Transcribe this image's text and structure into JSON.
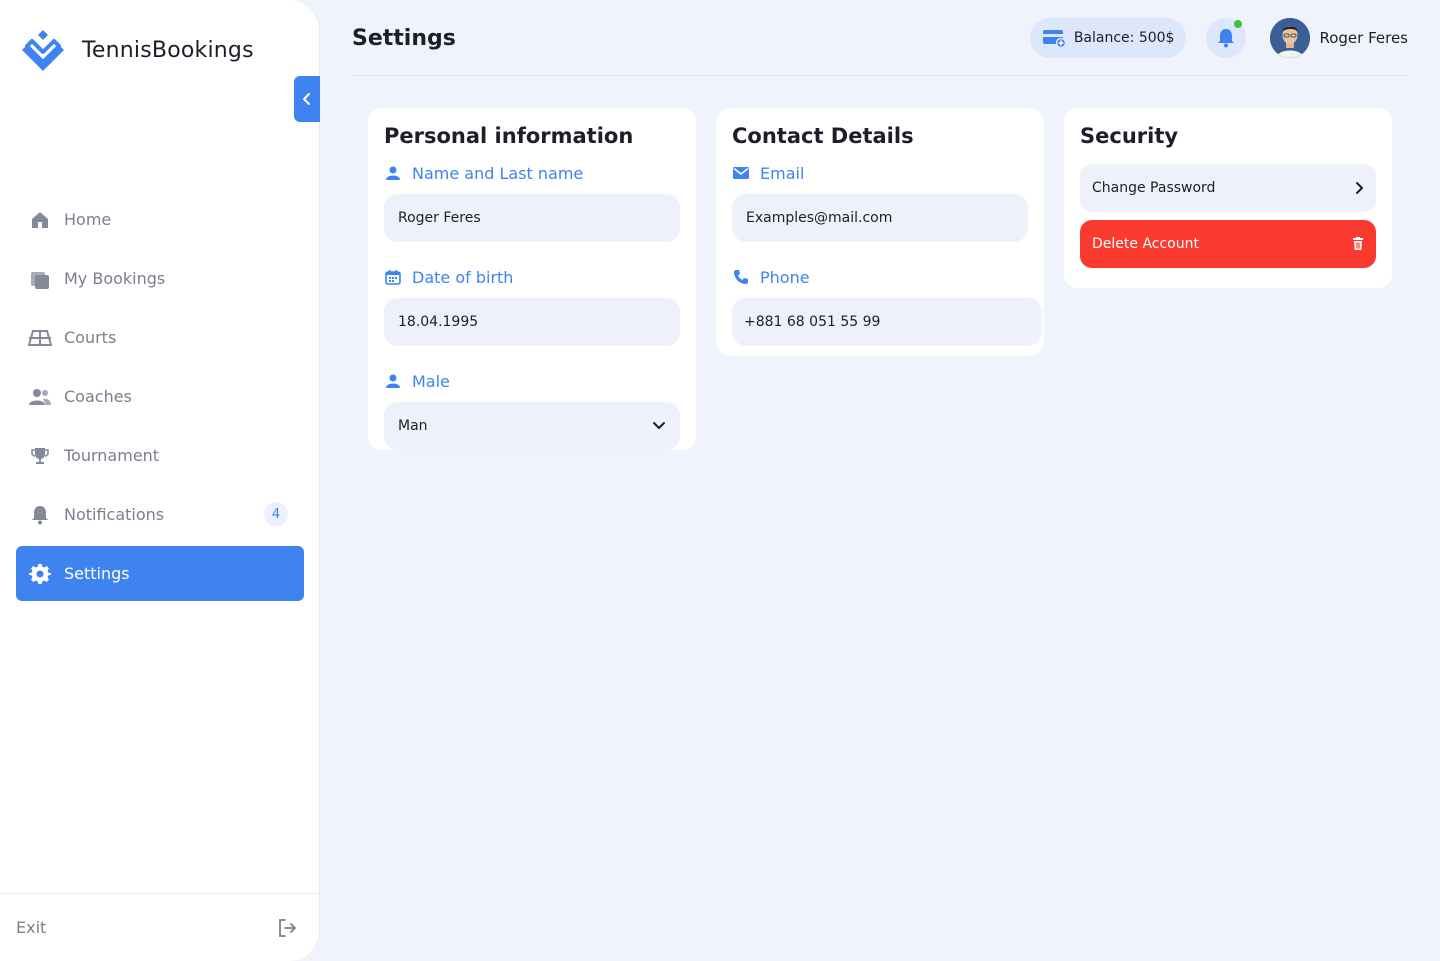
{
  "app": {
    "name": "TennisBookings"
  },
  "sidebar": {
    "items": [
      {
        "label": "Home",
        "icon": "home-icon"
      },
      {
        "label": "My Bookings",
        "icon": "bookings-icon"
      },
      {
        "label": "Courts",
        "icon": "court-icon"
      },
      {
        "label": "Coaches",
        "icon": "users-icon"
      },
      {
        "label": "Tournament",
        "icon": "trophy-icon"
      },
      {
        "label": "Notifications",
        "icon": "bell-icon",
        "badge": "4"
      },
      {
        "label": "Settings",
        "icon": "gear-icon",
        "active": true
      }
    ],
    "footer": {
      "exit_label": "Exit"
    }
  },
  "header": {
    "title": "Settings",
    "balance": "Balance: 500$",
    "user_name": "Roger Feres"
  },
  "personal": {
    "title": "Personal information",
    "name_label": "Name and Last name",
    "name_value": "Roger Feres",
    "dob_label": "Date of birth",
    "dob_value": "18.04.1995",
    "gender_label": "Male",
    "gender_value": "Man"
  },
  "contact": {
    "title": "Contact Details",
    "email_label": "Email",
    "email_value": "Examples@mail.com",
    "phone_label": "Phone",
    "phone_value": "+881 68 051 55 99"
  },
  "security": {
    "title": "Security",
    "change_password": "Change Password",
    "delete_account": "Delete Account"
  },
  "colors": {
    "accent": "#3f83f1",
    "danger": "#fb3a2f",
    "background": "#f0f3fb",
    "online": "#3cc13b"
  }
}
